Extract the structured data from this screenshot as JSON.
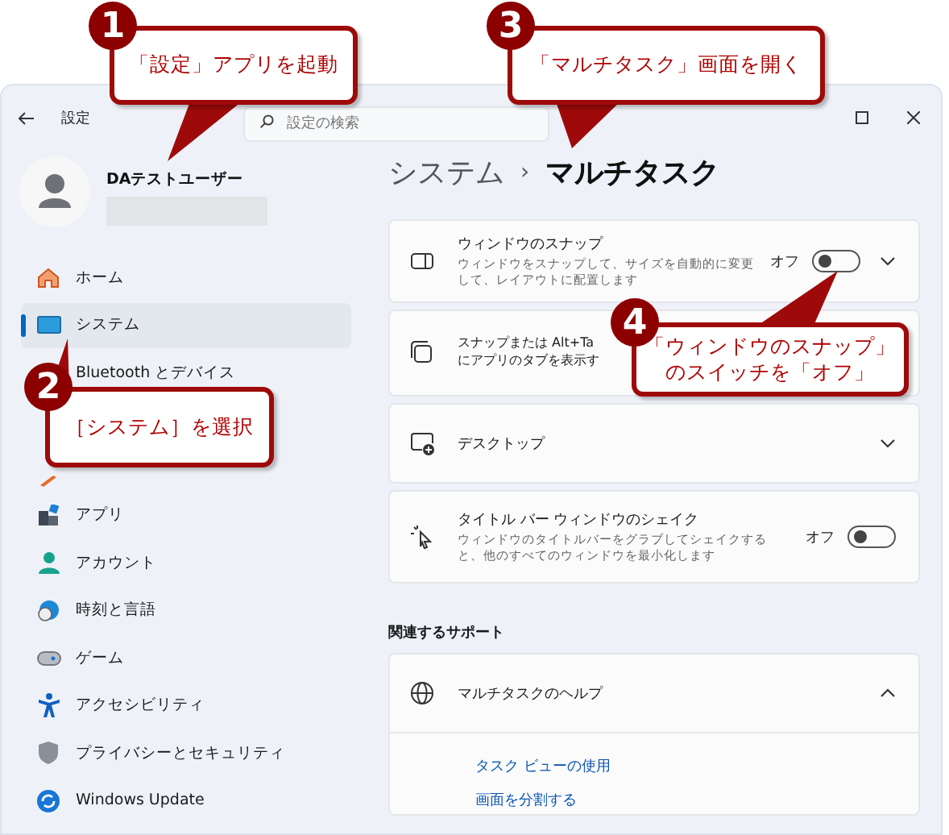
{
  "window": {
    "title": "設定",
    "search": {
      "placeholder": "設定の検索"
    }
  },
  "profile": {
    "name": "DAテストユーザー"
  },
  "sidebar": {
    "items": [
      {
        "label": "ホーム",
        "selected": false
      },
      {
        "label": "システム",
        "selected": true
      },
      {
        "label": "Bluetooth とデバイス",
        "selected": false
      },
      {
        "kind": "covered"
      },
      {
        "kind": "covered"
      },
      {
        "label": "アプリ",
        "selected": false
      },
      {
        "label": "アカウント",
        "selected": false
      },
      {
        "label": "時刻と言語",
        "selected": false
      },
      {
        "label": "ゲーム",
        "selected": false
      },
      {
        "label": "アクセシビリティ",
        "selected": false
      },
      {
        "label": "プライバシーとセキュリティ",
        "selected": false
      },
      {
        "label": "Windows Update",
        "selected": false
      }
    ]
  },
  "breadcrumb": {
    "parent": "システム",
    "separator": "›",
    "current": "マルチタスク"
  },
  "settings": [
    {
      "kind": "toggle",
      "title": "ウィンドウのスナップ",
      "description": "ウィンドウをスナップして、サイズを自動的に変更して、レイアウトに配置します",
      "state_label": "オフ",
      "on": false,
      "expanded": false
    },
    {
      "kind": "wrapped",
      "lines": [
        "スナップまたは Alt+Ta",
        "にアプリのタブを表示す"
      ]
    },
    {
      "kind": "expand",
      "title": "デスクトップ",
      "expanded": false
    },
    {
      "kind": "toggle",
      "title": "タイトル バー ウィンドウのシェイク",
      "description": "ウィンドウのタイトルバーをグラブしてシェイクすると、他のすべてのウィンドウを最小化します",
      "state_label": "オフ",
      "on": false
    }
  ],
  "related": {
    "heading": "関連するサポート",
    "help": {
      "title": "マルチタスクのヘルプ",
      "expanded": true,
      "links": [
        "タスク ビューの使用",
        "画面を分割する"
      ]
    }
  },
  "callouts": [
    {
      "number": "1",
      "lines": [
        "「設定」アプリを起動"
      ]
    },
    {
      "number": "3",
      "lines": [
        "「マルチタスク」画面を開く"
      ]
    },
    {
      "number": "2",
      "lines": [
        "［システム］を選択"
      ]
    },
    {
      "number": "4",
      "lines": [
        "「ウィンドウのスナップ」",
        "のスイッチを「オフ」"
      ]
    }
  ]
}
